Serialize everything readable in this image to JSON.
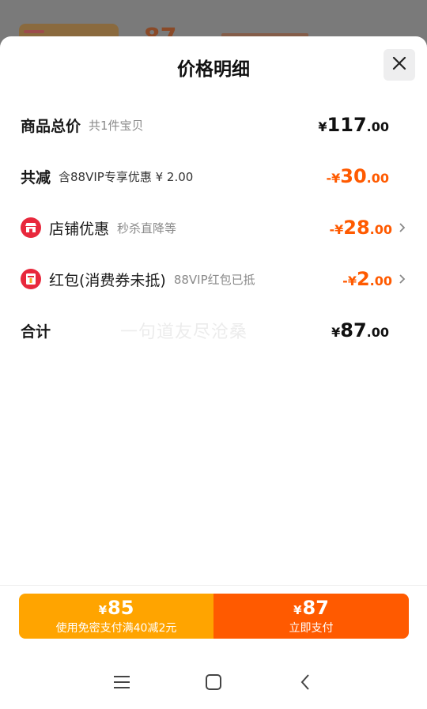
{
  "backdrop": {
    "price_symbol": "¥",
    "price": "87"
  },
  "header": {
    "title": "价格明细"
  },
  "rows": {
    "total": {
      "label": "商品总价",
      "sub": "共1件宝贝",
      "symbol": "¥",
      "int": "117",
      "dec": ".00"
    },
    "discount": {
      "label": "共减",
      "sub": "含88VIP专享优惠 ¥ 2.00",
      "symbol": "-¥",
      "int": "30",
      "dec": ".00"
    },
    "shop": {
      "label": "店铺优惠",
      "sub": "秒杀直降等",
      "symbol": "-¥",
      "int": "28",
      "dec": ".00"
    },
    "redpacket": {
      "label": "红包(消费券未抵)",
      "sub": "88VIP红包已抵",
      "symbol": "-¥",
      "int": "2",
      "dec": ".00"
    },
    "sum": {
      "label": "合计",
      "symbol": "¥",
      "int": "87",
      "dec": ".00"
    }
  },
  "watermark": "一句道友尽沧桑",
  "footer": {
    "password_free": {
      "symbol": "¥",
      "price": "85",
      "label": "使用免密支付满40减2元"
    },
    "pay_now": {
      "symbol": "¥",
      "price": "87",
      "label": "立即支付"
    }
  },
  "colors": {
    "accent_orange": "#ff5a00",
    "accent_yellow": "#ffa400",
    "icon_red": "#e8283c"
  },
  "icons": {
    "close": "close-icon",
    "shop": "shop-icon",
    "redpacket": "red-packet-icon",
    "chevron": "chevron-right-icon",
    "nav_menu": "menu-icon",
    "nav_home": "home-icon",
    "nav_back": "back-icon"
  }
}
